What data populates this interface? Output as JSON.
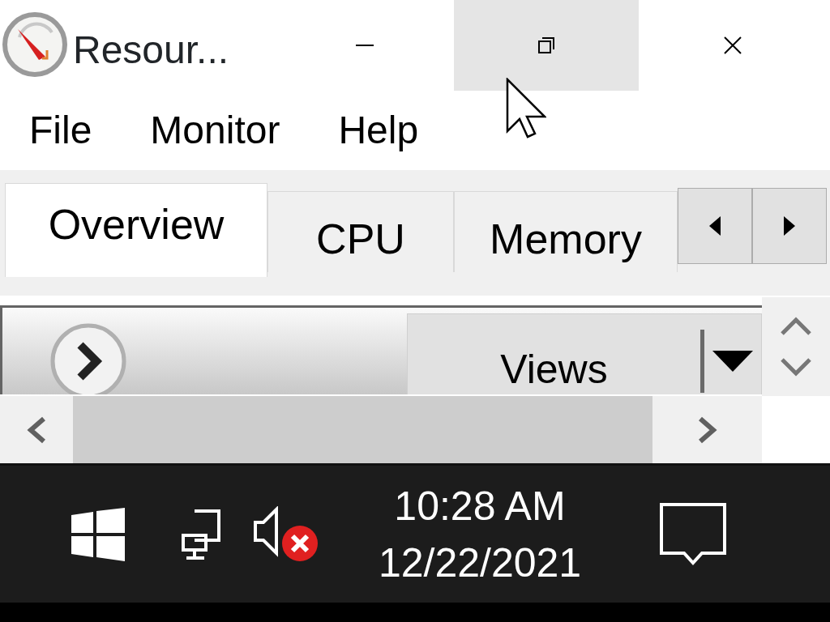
{
  "window": {
    "title": "Resour...",
    "buttons": [
      {
        "kind": "minimize",
        "hovered": false
      },
      {
        "kind": "restore",
        "hovered": true
      },
      {
        "kind": "close",
        "hovered": false
      }
    ]
  },
  "menu": [
    "File",
    "Monitor",
    "Help"
  ],
  "tabs": [
    {
      "label": "Overview",
      "selected": true
    },
    {
      "label": "CPU",
      "selected": false
    },
    {
      "label": "Memory",
      "selected": false
    }
  ],
  "section": {
    "expanded": false,
    "button": "Views"
  },
  "taskbar": {
    "volume_muted": true,
    "time": "10:28 AM",
    "date": "12/22/2021"
  }
}
